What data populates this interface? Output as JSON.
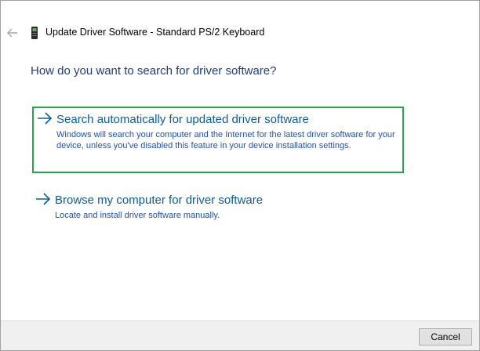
{
  "window": {
    "title": "Update Driver Software - Standard PS/2 Keyboard",
    "back_icon": "back-arrow-icon",
    "device_icon": "keyboard-device-icon"
  },
  "main": {
    "heading": "How do you want to search for driver software?",
    "options": [
      {
        "title": "Search automatically for updated driver software",
        "description": "Windows will search your computer and the Internet for the latest driver software for your device, unless you've disabled this feature in your device installation settings.",
        "icon": "arrow-right-icon",
        "selected": true
      },
      {
        "title": "Browse my computer for driver software",
        "description": "Locate and install driver software manually.",
        "icon": "arrow-right-icon",
        "selected": false
      }
    ]
  },
  "footer": {
    "cancel_label": "Cancel"
  },
  "colors": {
    "heading": "#1e3c8c",
    "option_title": "#0a5ca8",
    "option_description": "#1f50c8",
    "selection_border": "#22a84a",
    "footer_background": "#f0f0f0"
  }
}
